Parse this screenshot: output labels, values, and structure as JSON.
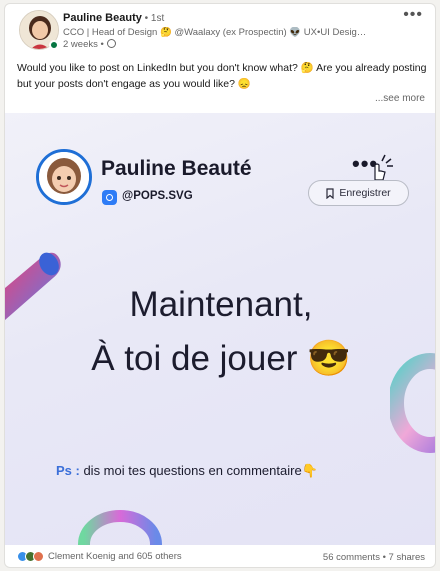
{
  "post": {
    "author_name": "Pauline Beauty",
    "author_degree": " • 1st",
    "headline": "CCO | Head of Design 🤔 @Waalaxy (ex Prospectin) 👽 UX•UI Designer @W...",
    "time_ago": "2 weeks • ",
    "body_text": "Would you like to post on LinkedIn but you don't know what? 🤔 Are you already posting but your posts don't engage as you would like? 😞",
    "see_more": "...see more",
    "more_icon": "more-horizontal-icon"
  },
  "image": {
    "name": "Pauline Beauté",
    "handle": "@POPS.SVG",
    "dots": "•••",
    "save_label": "Enregistrer",
    "title_line1": "Maintenant,",
    "title_line2": "À toi de jouer 😎",
    "ps_label": "Ps :",
    "ps_text": " dis moi tes questions en commentaire👇",
    "accent_color": "#3b6fd9"
  },
  "footer": {
    "reactions_text": "Clement Koenig and 605 others",
    "comments_shares": "56 comments • 7 shares"
  }
}
